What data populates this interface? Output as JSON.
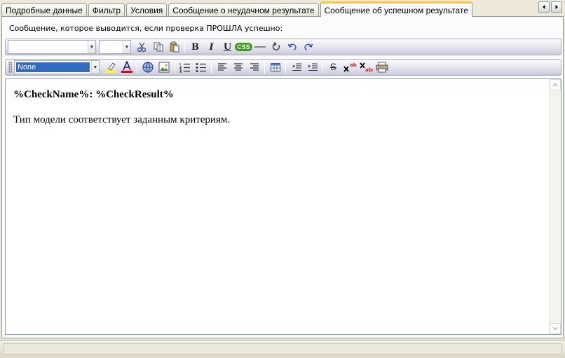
{
  "tabs": [
    {
      "label": "Подробные данные",
      "active": false
    },
    {
      "label": "Фильтр",
      "active": false
    },
    {
      "label": "Условия",
      "active": false
    },
    {
      "label": "Сообщение о неудачном результате",
      "active": false
    },
    {
      "label": "Сообщение об успешном результате",
      "active": true
    }
  ],
  "caption": "Сообщение, которое выводится, если проверка ПРОШЛА успешно:",
  "toolbar1": {
    "font_value": "",
    "size_value": "",
    "bold_label": "B",
    "italic_label": "I",
    "underline_label": "U",
    "css_label": "CSS"
  },
  "toolbar2": {
    "style_value": "None",
    "strike_label": "S"
  },
  "editor": {
    "heading": "%CheckName%: %CheckResult%",
    "body": "Тип модели соответствует заданным критериям."
  },
  "colors": {
    "active_tab_accent": "#ffc83c",
    "css_badge": "#3b9b1a",
    "highlight": "#ffff00",
    "font_color": "#e00000",
    "selection": "#316ac5"
  }
}
